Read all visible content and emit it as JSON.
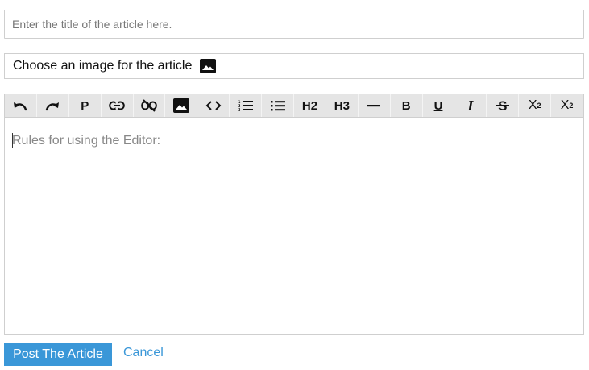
{
  "title_input": {
    "placeholder": "Enter the title of the article here.",
    "value": ""
  },
  "image_chooser": {
    "label": "Choose an image for the article",
    "icon": "image-icon"
  },
  "toolbar": {
    "buttons": [
      {
        "name": "undo",
        "icon": "undo-icon"
      },
      {
        "name": "redo",
        "icon": "redo-icon"
      },
      {
        "name": "paragraph",
        "label": "P"
      },
      {
        "name": "link",
        "icon": "link-icon"
      },
      {
        "name": "unlink",
        "icon": "unlink-icon"
      },
      {
        "name": "image",
        "icon": "image-icon"
      },
      {
        "name": "code",
        "icon": "code-icon"
      },
      {
        "name": "ordered-list",
        "icon": "ordered-list-icon"
      },
      {
        "name": "unordered-list",
        "icon": "unordered-list-icon"
      },
      {
        "name": "heading-2",
        "label": "H2"
      },
      {
        "name": "heading-3",
        "label": "H3"
      },
      {
        "name": "horizontal-rule",
        "icon": "horizontal-rule-icon"
      },
      {
        "name": "bold",
        "label": "B"
      },
      {
        "name": "underline",
        "label": "U"
      },
      {
        "name": "italic",
        "label": "I"
      },
      {
        "name": "strikethrough",
        "label": "S"
      },
      {
        "name": "subscript",
        "label": "X",
        "mark": "2"
      },
      {
        "name": "superscript",
        "label": "X",
        "mark": "2"
      }
    ]
  },
  "editor": {
    "placeholder": "Rules for using the Editor:"
  },
  "actions": {
    "post_label": "Post The Article",
    "cancel_label": "Cancel"
  },
  "colors": {
    "accent": "#3a97d8",
    "toolbar_bg": "#e5e5e5",
    "border": "#cfcfcf"
  }
}
